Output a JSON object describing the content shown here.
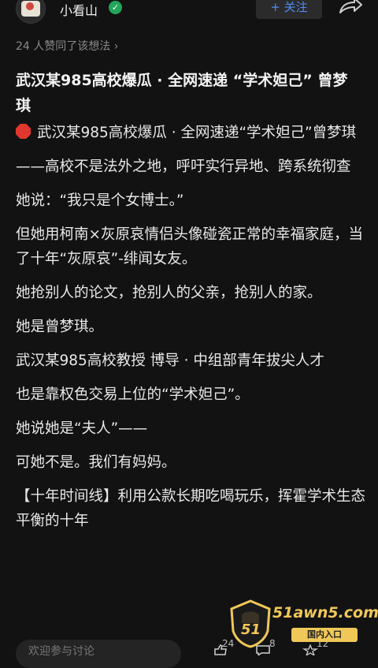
{
  "header": {
    "username": "小看山",
    "follow_label": "+ 关注"
  },
  "likes": {
    "text": "24 人赞同了该想法 ›"
  },
  "post": {
    "title": "武汉某985高校爆瓜 · 全网速递 “学术妲己” 曾梦琪",
    "paragraphs": [
      "武汉某985高校爆瓜 · 全网速递“学术妲己”曾梦琪",
      "——高校不是法外之地，呼吁实行异地、跨系统彻查",
      "她说：“我只是个女博士。”",
      "但她用柯南×灰原哀情侣头像碰瓷正常的幸福家庭，当了十年“灰原哀”-绯闻女友。",
      "她抢别人的论文，抢别人的父亲，抢别人的家。",
      "她是曾梦琪。",
      "武汉某985高校教授 博导 · 中组部青年拔尖人才",
      "也是靠权色交易上位的“学术妲己”。",
      "她说她是“夫人”——",
      "可她不是。我们有妈妈。",
      "【十年时间线】利用公款长期吃喝玩乐，挥霍学术生态平衡的十年"
    ]
  },
  "bottom": {
    "comment_placeholder": "欢迎参与讨论",
    "likes_count": "24",
    "comments_count": "8",
    "favorites_count": "12"
  },
  "watermark": {
    "name": "51awn5.com",
    "tag": "国内入口",
    "logo_text": "51"
  },
  "colors": {
    "background": "#121212",
    "accent_blue": "#4d8cf5",
    "verified_green": "#22a65a",
    "stop_red": "#e0372e",
    "watermark_gold": "#f0c858"
  }
}
